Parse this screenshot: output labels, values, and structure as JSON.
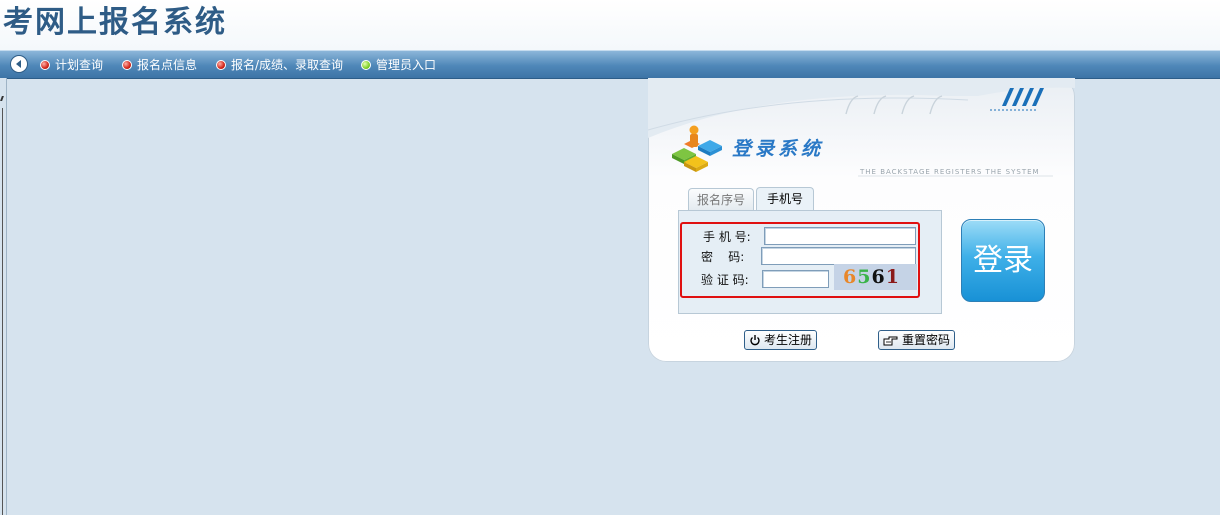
{
  "header": {
    "title": "考网上报名系统"
  },
  "nav": {
    "items": [
      {
        "label": "计划查询",
        "dot": "red"
      },
      {
        "label": "报名点信息",
        "dot": "red"
      },
      {
        "label": "报名/成绩、录取查询",
        "dot": "red"
      },
      {
        "label": "管理员入口",
        "dot": "green"
      }
    ]
  },
  "login": {
    "title": "登录系统",
    "subtitle": "THE BACKSTAGE REGISTERS THE SYSTEM",
    "tabs": [
      {
        "label": "报名序号",
        "active": false
      },
      {
        "label": "手机号",
        "active": true
      }
    ],
    "fields": {
      "phone_label": "手 机 号:",
      "phone_value": "",
      "password_label": "密    码:",
      "password_value": "",
      "captcha_label": "验 证 码:",
      "captcha_value": ""
    },
    "captcha": {
      "digits": [
        {
          "char": "6",
          "color": "#e8872a"
        },
        {
          "char": "5",
          "color": "#3ab34a"
        },
        {
          "char": "6",
          "color": "#111111"
        },
        {
          "char": "1",
          "color": "#8b1a1a"
        }
      ]
    },
    "submit_label": "登录",
    "register_label": "考生注册",
    "reset_label": "重置密码"
  },
  "colors": {
    "title": "#2e5c86",
    "nav_bar": "#4f87b8",
    "background": "#d6e3ee",
    "highlight_border": "#e01010",
    "login_button": "#3fb0e8"
  }
}
